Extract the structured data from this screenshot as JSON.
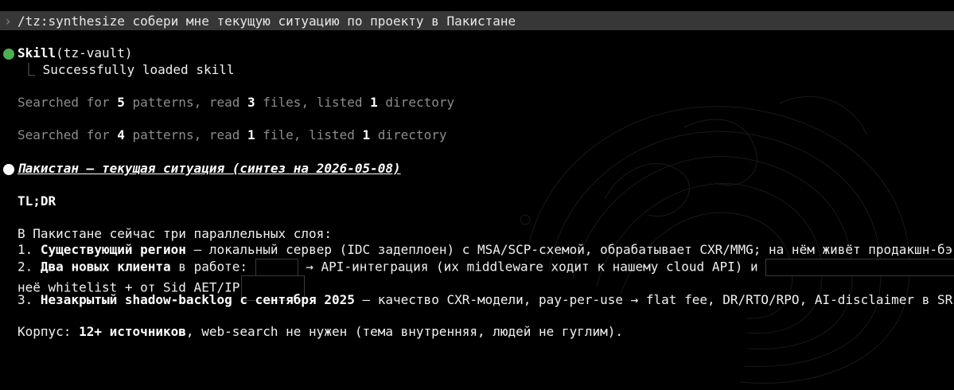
{
  "prompt": {
    "chevron": "›",
    "text": "/tz:synthesize собери мне текущую ситуацию по проекту в Пакистане"
  },
  "skill": {
    "name": "Skill",
    "arg": "(tz-vault)",
    "status_color": "#4caf50",
    "result_branch": "⎿",
    "result": "Successfully loaded skill"
  },
  "search_1": {
    "p1": "Searched for ",
    "patterns": "5",
    "p2": " patterns, read ",
    "files": "3",
    "p3": " files, listed ",
    "dirs": "1",
    "p4": " directory"
  },
  "search_2": {
    "p1": "Searched for ",
    "patterns": "4",
    "p2": " patterns, read ",
    "files": "1",
    "p3": " file, listed ",
    "dirs": "1",
    "p4": " directory"
  },
  "response": {
    "bullet_color": "#ffffff",
    "heading": "Пакистан — текущая ситуация (синтез на 2026-05-08)",
    "tldr": "TL;DR",
    "intro": "В Пакистане сейчас три параллельных слоя:",
    "item1_num": "1. ",
    "item1_bold": "Существующий регион",
    "item1_rest": " — локальный сервер (IDC задеплоен) с MSA/SCP-схемой, обрабатывает CXR/MMG; на нём живёт продакшн-бэк.",
    "item2_num": "2. ",
    "item2_bold": "Два новых клиента",
    "item2_a": " в работе: ",
    "item2_b": " → API-интеграция (их middleware ходит к нашему cloud API) и ",
    "item2_c": " —",
    "item2_line2": "неё whitelist + от Sid AET/IP",
    "item3_num": "3. ",
    "item3_bold": "Незакрытый shadow-backlog с сентября 2025",
    "item3_rest": " — качество CXR-модели, pay-per-use → flat fee, DR/RTO/RPO, AI-disclaimer в SR, JP",
    "corpus_label": "Корпус: ",
    "corpus_bold": "12+ источников",
    "corpus_rest": ", web-search не нужен (тема внутренняя, людей не гуглим)."
  }
}
